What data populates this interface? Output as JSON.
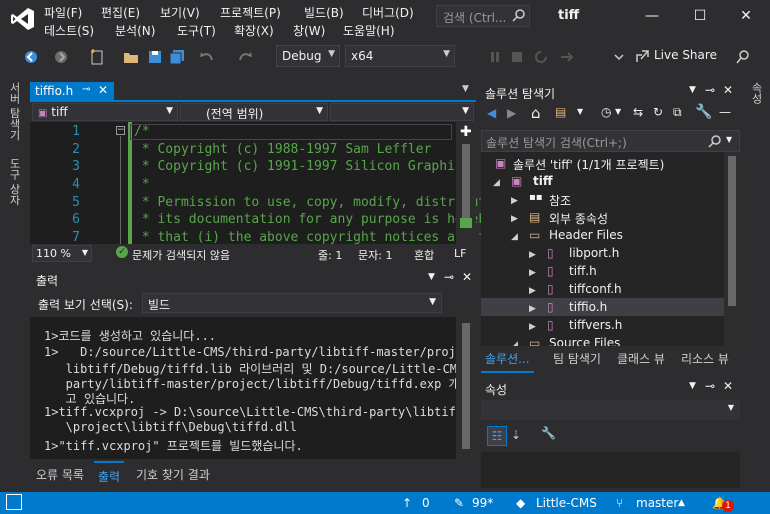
{
  "menu": {
    "row1": [
      "파일(F)",
      "편집(E)",
      "보기(V)",
      "프로젝트(P)",
      "빌드(B)",
      "디버그(D)"
    ],
    "row2": [
      "테스트(S)",
      "분석(N)",
      "도구(T)",
      "확장(X)",
      "창(W)",
      "도움말(H)"
    ]
  },
  "search": {
    "placeholder": "검색 (Ctrl..."
  },
  "window_title": "tiff",
  "toolbar": {
    "config": "Debug",
    "platform": "x64",
    "live_share": "Live Share"
  },
  "left_tabs": [
    "서버 탐색기",
    "도구 상자"
  ],
  "right_tab": "속성",
  "editor": {
    "tab_label": "tiffio.h",
    "nav_project": "tiff",
    "nav_scope": "(전역 범위)",
    "lines": [
      {
        "n": "1",
        "text": "/*"
      },
      {
        "n": "2",
        "text": " * Copyright (c) 1988-1997 Sam Leffler"
      },
      {
        "n": "3",
        "text": " * Copyright (c) 1991-1997 Silicon Graphics, I"
      },
      {
        "n": "4",
        "text": " *"
      },
      {
        "n": "5",
        "text": " * Permission to use, copy, modify, distribute"
      },
      {
        "n": "6",
        "text": " * its documentation for any purpose is hereby"
      },
      {
        "n": "7",
        "text": " * that (i) the above copyright notices and th"
      }
    ],
    "zoom": "110 %",
    "issues": "문제가 검색되지 않음",
    "line": "줄: 1",
    "col": "문자: 1",
    "mode": "혼합",
    "eol": "LF"
  },
  "output": {
    "title": "출력",
    "show_label": "출력 보기 선택(S):",
    "show_value": "빌드",
    "lines": [
      "1>코드를 생성하고 있습니다...",
      "1>   D:/source/Little-CMS/third-party/libtiff-master/project/",
      "   libtiff/Debug/tiffd.lib 라이브러리 및 D:/source/Little-CMS/third-",
      "   party/libtiff-master/project/libtiff/Debug/tiffd.exp 개체를 생성하",
      "   고 있습니다.",
      "1>tiff.vcxproj -> D:\\source\\Little-CMS\\third-party\\libtiff-master",
      "   \\project\\libtiff\\Debug\\tiffd.dll",
      "1>\"tiff.vcxproj\" 프로젝트를 빌드했습니다."
    ],
    "bottom_tabs": [
      "오류 목록",
      "출력",
      "기호 찾기 결과"
    ]
  },
  "solution": {
    "title": "솔루션 탐색기",
    "search_placeholder": "솔루션 탐색기 검색(Ctrl+;)",
    "root": "솔루션 'tiff' (1/1개 프로젝트)",
    "project": "tiff",
    "items": [
      {
        "label": "참조",
        "level": 2,
        "arrow": "▶"
      },
      {
        "label": "외부 종속성",
        "level": 2,
        "arrow": "▶"
      },
      {
        "label": "Header Files",
        "level": 2,
        "arrow": "◢"
      },
      {
        "label": "libport.h",
        "level": 3,
        "arrow": "▶"
      },
      {
        "label": "tiff.h",
        "level": 3,
        "arrow": "▶"
      },
      {
        "label": "tiffconf.h",
        "level": 3,
        "arrow": "▶"
      },
      {
        "label": "tiffio.h",
        "level": 3,
        "arrow": "▶",
        "selected": true
      },
      {
        "label": "tiffvers.h",
        "level": 3,
        "arrow": "▶"
      },
      {
        "label": "Source Files",
        "level": 2,
        "arrow": "◢"
      }
    ],
    "tabs": [
      "솔루션...",
      "팀 탐색기",
      "클래스 뷰",
      "리소스 뷰"
    ]
  },
  "properties": {
    "title": "속성"
  },
  "statusbar": {
    "up": "0",
    "edits": "99*",
    "repo": "Little-CMS",
    "branch": "master",
    "notifications": "1"
  },
  "colors": {
    "accent": "#007acc",
    "comment": "#57a64a",
    "line_number": "#2b91af"
  }
}
